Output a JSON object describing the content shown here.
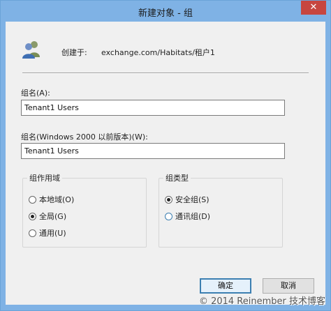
{
  "window": {
    "title": "新建对象 - 组",
    "close_glyph": "✕"
  },
  "created": {
    "label": "创建于:",
    "value": "exchange.com/Habitats/租户1"
  },
  "group_name": {
    "label": "组名(A):",
    "value": "Tenant1 Users"
  },
  "group_name_legacy": {
    "label": "组名(Windows 2000 以前版本)(W):",
    "value": "Tenant1 Users"
  },
  "group_scope": {
    "title": "组作用域",
    "options": [
      "本地域(O)",
      "全局(G)",
      "通用(U)"
    ],
    "selected": "全局(G)"
  },
  "group_type": {
    "title": "组类型",
    "options": [
      "安全组(S)",
      "通讯组(D)"
    ],
    "selected": "安全组(S)"
  },
  "buttons": {
    "ok": "确定",
    "cancel": "取消"
  },
  "watermark": "© 2014 Reinember 技术博客",
  "icons": {
    "group": "users-group-icon"
  }
}
